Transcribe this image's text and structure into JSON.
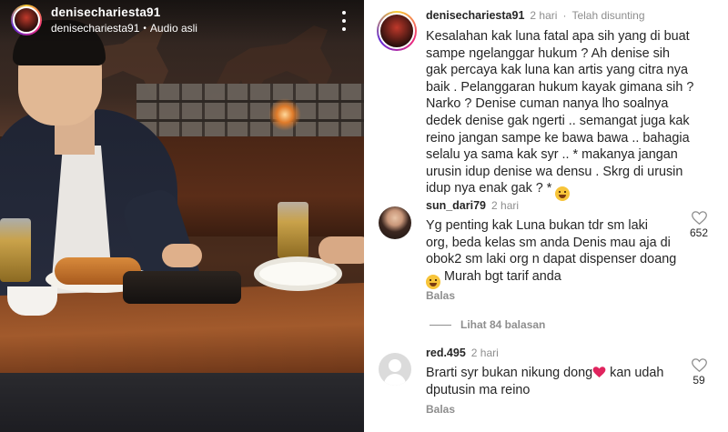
{
  "video": {
    "username": "denisechariesta91",
    "subtitle_user": "denisechariesta91",
    "audio_label": "Audio asli",
    "dot": "•"
  },
  "caption": {
    "username": "denisechariesta91",
    "time": "2 hari",
    "dot": "·",
    "edited": "Telah disunting",
    "lines": [
      "Kesalahan kak luna fatal apa sih yang di buat",
      "sampe ngelanggar hukum ? Ah denise sih",
      "gak percaya kak luna kan artis yang citra nya",
      "baik . Pelanggaran hukum kayak gimana sih ?",
      "Narko ? Denise cuman nanya lho soalnya",
      "dedek denise gak ngerti .. semangat juga kak",
      "reino jangan sampe ke bawa bawa .. bahagia",
      "selalu ya sama kak syr .. * makanya jangan",
      "urusin idup denise wa densu . Skrg di urusin",
      "idup nya enak gak ? *"
    ],
    "end_emoji": "🤪"
  },
  "comments": [
    {
      "username": "sun_dari79",
      "time": "2 hari",
      "lines": [
        "Yg penting kak Luna bukan tdr sm laki",
        "org, beda kelas sm anda Denis mau aja di",
        "obok2 sm laki org n dapat dispenser doang",
        "Murah bgt tarif anda"
      ],
      "line4_emoji": "😂",
      "likes": "652",
      "reply_label": "Balas"
    },
    {
      "username": "red.495",
      "time": "2 hari",
      "line1": "Brarti syr bukan nikung dong",
      "line1_tail": " kan udah",
      "line2": "dputusin ma reino",
      "likes": "59",
      "reply_label": "Balas"
    }
  ],
  "view_replies": "Lihat 84 balasan",
  "icons": {
    "more": "more-vertical-icon",
    "like": "heart-outline-icon",
    "heart_emoji": "red-heart-icon"
  },
  "colors": {
    "text": "#262626",
    "muted": "#8e8e8e",
    "heart_red": "#e0245e"
  }
}
